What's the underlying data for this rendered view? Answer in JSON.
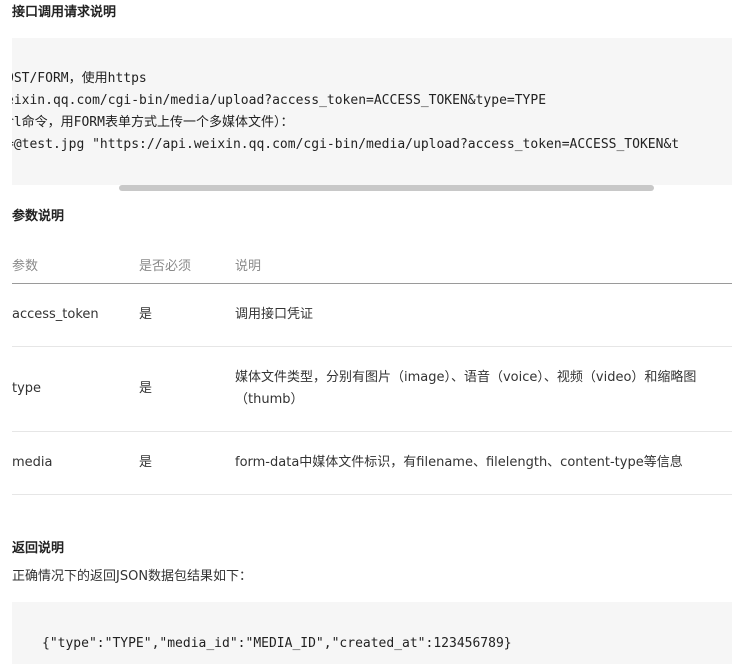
{
  "section_request": {
    "heading": "接口调用请求说明",
    "code_lines": [
      "OST/FORM，使用https",
      "eixin.qq.com/cgi-bin/media/upload?access_token=ACCESS_TOKEN&type=TYPE",
      "rl命令，用FORM表单方式上传一个多媒体文件）：",
      "=@test.jpg \"https://api.weixin.qq.com/cgi-bin/media/upload?access_token=ACCESS_TOKEN&t"
    ]
  },
  "section_params": {
    "heading": "参数说明",
    "columns": [
      "参数",
      "是否必须",
      "说明"
    ],
    "rows": [
      [
        "access_token",
        "是",
        "调用接口凭证"
      ],
      [
        "type",
        "是",
        "媒体文件类型，分别有图片（image）、语音（voice）、视频（video）和缩略图（thumb）"
      ],
      [
        "media",
        "是",
        "form-data中媒体文件标识，有filename、filelength、content-type等信息"
      ]
    ]
  },
  "section_return": {
    "heading": "返回说明",
    "description": "正确情况下的返回JSON数据包结果如下：",
    "code_line": "{\"type\":\"TYPE\",\"media_id\":\"MEDIA_ID\",\"created_at\":123456789}"
  }
}
